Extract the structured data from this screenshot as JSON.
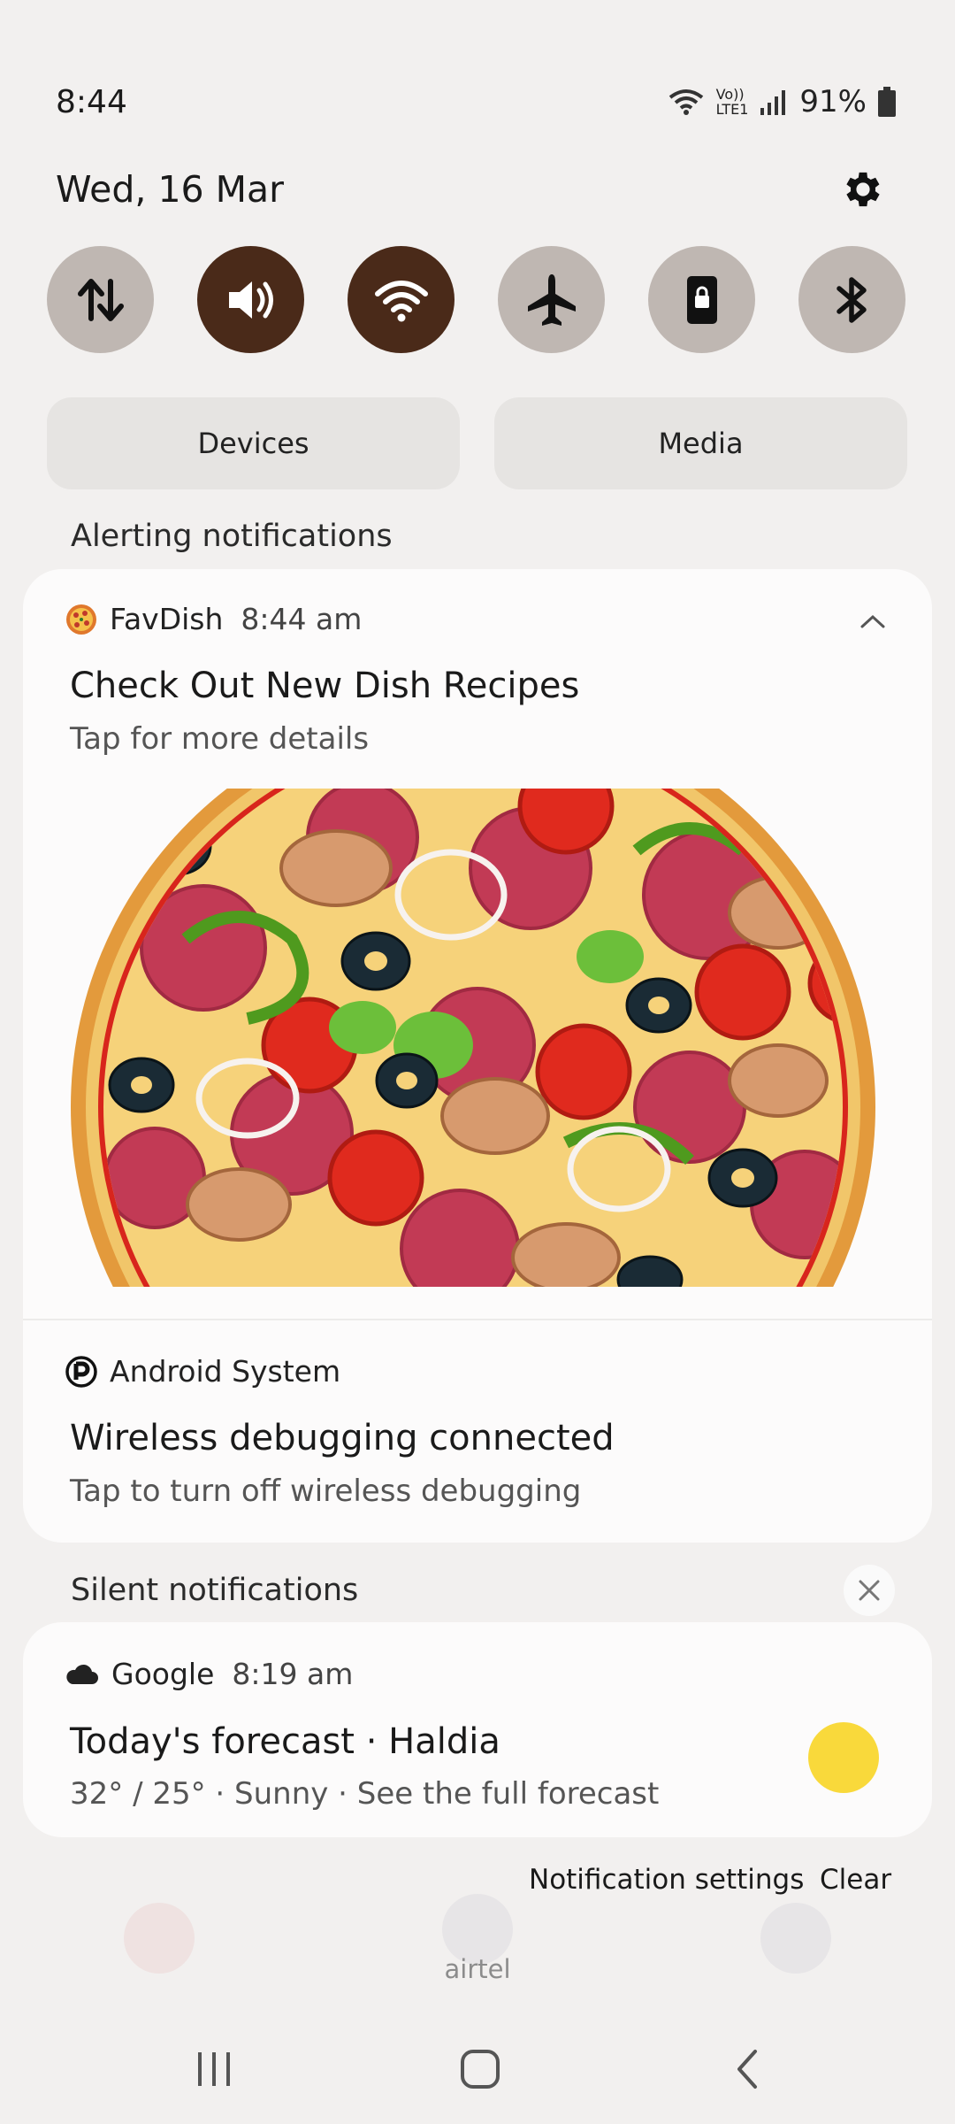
{
  "status_bar": {
    "time": "8:44",
    "network_label_top": "Vo))",
    "network_label_bottom": "LTE1",
    "battery": "91%"
  },
  "header": {
    "date": "Wed, 16 Mar",
    "settings_icon": "gear-icon"
  },
  "quick_settings": [
    {
      "name": "mobile-data",
      "icon": "arrows-updown-icon",
      "active": false
    },
    {
      "name": "sound",
      "icon": "speaker-icon",
      "active": true
    },
    {
      "name": "wifi",
      "icon": "wifi-icon",
      "active": true
    },
    {
      "name": "airplane-mode",
      "icon": "airplane-icon",
      "active": false
    },
    {
      "name": "rotation-lock",
      "icon": "lock-rotation-icon",
      "active": false
    },
    {
      "name": "bluetooth",
      "icon": "bluetooth-icon",
      "active": false
    }
  ],
  "pills": {
    "devices": "Devices",
    "media": "Media"
  },
  "alerting": {
    "label": "Alerting notifications",
    "favdish": {
      "app": "FavDish",
      "time": "8:44 am",
      "title": "Check Out New Dish Recipes",
      "subtitle": "Tap for more details"
    },
    "android": {
      "app": "Android System",
      "title": "Wireless debugging connected",
      "subtitle": "Tap to turn off wireless debugging"
    }
  },
  "silent": {
    "label": "Silent notifications",
    "google": {
      "app": "Google",
      "time": "8:19 am",
      "title": "Today's forecast · Haldia",
      "subtitle": "32° / 25° · Sunny · See the full forecast"
    }
  },
  "footer": {
    "notification_settings": "Notification settings",
    "clear": "Clear",
    "carrier": "airtel"
  },
  "colors": {
    "accent_dark": "#4a2a19",
    "tile_off": "#bfb7b2",
    "sun": "#f9d93b"
  }
}
